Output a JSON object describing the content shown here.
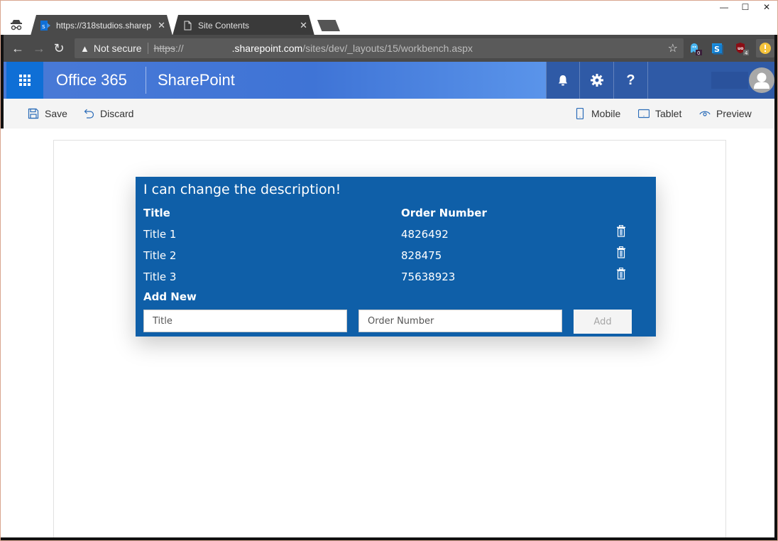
{
  "browser": {
    "tabs": [
      {
        "label": "https://318studios.sharep",
        "icon": "sharepoint-favicon",
        "active": true
      },
      {
        "label": "Site Contents",
        "icon": "page-icon",
        "active": false
      }
    ],
    "window_controls": {
      "minimize": "—",
      "maximize": "☐",
      "close": "✕"
    },
    "address": {
      "security_label": "Not secure",
      "scheme": "https",
      "scheme_suffix": "://",
      "host": ".sharepoint.com",
      "path": "/sites/dev/_layouts/15/workbench.aspx"
    },
    "extensions": [
      {
        "name": "ghostery",
        "badge": "0"
      },
      {
        "name": "skype",
        "badge": ""
      },
      {
        "name": "ublock",
        "badge": "4"
      },
      {
        "name": "alert",
        "badge": ""
      }
    ]
  },
  "suitebar": {
    "brand": "Office 365",
    "app": "SharePoint",
    "icons": [
      "bell-icon",
      "gear-icon",
      "help-icon"
    ],
    "help_glyph": "?"
  },
  "commandbar": {
    "save": "Save",
    "discard": "Discard",
    "mobile": "Mobile",
    "tablet": "Tablet",
    "preview": "Preview"
  },
  "webpart": {
    "description": "I can change the description!",
    "columns": {
      "title": "Title",
      "order_number": "Order Number"
    },
    "rows": [
      {
        "title": "Title 1",
        "order_number": "4826492"
      },
      {
        "title": "Title 2",
        "order_number": "828475"
      },
      {
        "title": "Title 3",
        "order_number": "75638923"
      }
    ],
    "add_new_label": "Add New",
    "title_placeholder": "Title",
    "order_placeholder": "Order Number",
    "add_button": "Add",
    "accent_color": "#0f5fa8"
  }
}
